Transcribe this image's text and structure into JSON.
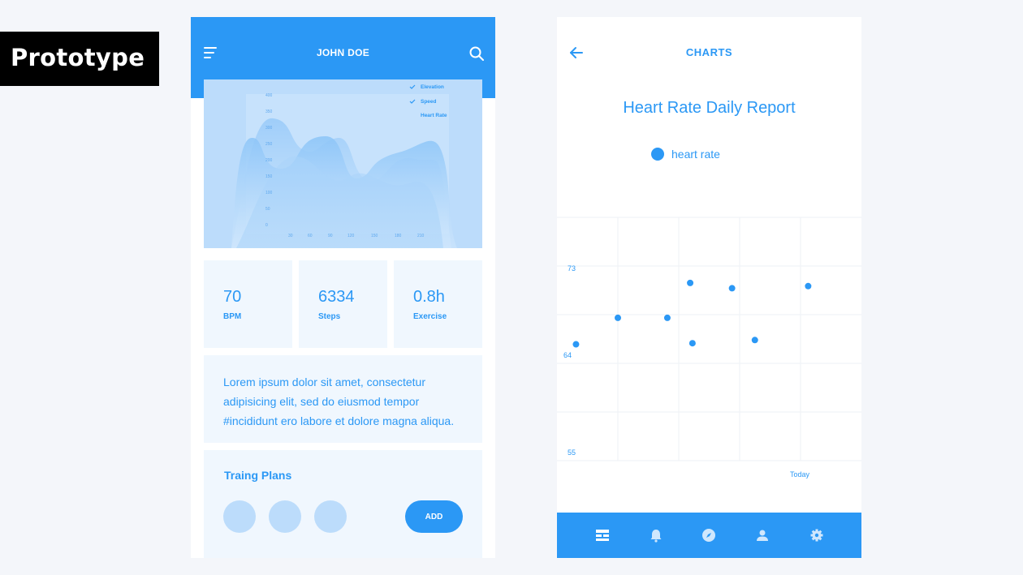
{
  "badge": {
    "label": "Prototype"
  },
  "left_screen": {
    "title": "JOHN DOE",
    "icons": {
      "menu": "menu-icon",
      "search": "search-icon"
    },
    "area_chart": {
      "legend": [
        {
          "label": "Elevation",
          "checked": true
        },
        {
          "label": "Speed",
          "checked": true
        },
        {
          "label": "Heart Rate",
          "checked": false
        }
      ],
      "y_ticks": [
        "400",
        "350",
        "300",
        "250",
        "200",
        "150",
        "100",
        "50",
        "0"
      ],
      "x_ticks": [
        "30",
        "60",
        "90",
        "120",
        "150",
        "180",
        "210"
      ]
    },
    "stats": [
      {
        "value": "70",
        "label": "BPM"
      },
      {
        "value": "6334",
        "label": "Steps"
      },
      {
        "value": "0.8h",
        "label": "Exercise"
      }
    ],
    "description": "Lorem ipsum dolor sit amet, consectetur adipisicing elit, sed do eiusmod tempor #incididunt ero labore et dolore magna aliqua.",
    "plans": {
      "title": "Traing Plans",
      "add_label": "ADD"
    }
  },
  "right_screen": {
    "title": "CHARTS",
    "icons": {
      "back": "arrow-left-icon"
    },
    "report_title": "Heart Rate Daily Report",
    "legend_label": "heart rate",
    "nav_icons": [
      "dashboard-icon",
      "bell-icon",
      "compass-icon",
      "user-icon",
      "settings-icon"
    ]
  },
  "colors": {
    "accent": "#2b98f5",
    "light_accent": "#bcdcfb",
    "card_bg": "#f0f7fe",
    "page_bg": "#f4f6fa"
  },
  "chart_data": {
    "type": "scatter",
    "title": "Heart Rate Daily Report",
    "series": [
      {
        "name": "heart rate",
        "values": [
          [
            0.25,
            64
          ],
          [
            0.8,
            66.5
          ],
          [
            1.45,
            66.5
          ],
          [
            1.75,
            69.8
          ],
          [
            1.78,
            64.1
          ],
          [
            2.3,
            69.3
          ],
          [
            2.6,
            64.4
          ],
          [
            3.3,
            69.5
          ]
        ]
      }
    ],
    "y_ticks": [
      "73",
      "64",
      "55"
    ],
    "x_ticks": [
      "Today"
    ],
    "ylim": [
      53,
      76
    ],
    "xlim": [
      0,
      4
    ],
    "grid": true,
    "legend_position": "top"
  }
}
